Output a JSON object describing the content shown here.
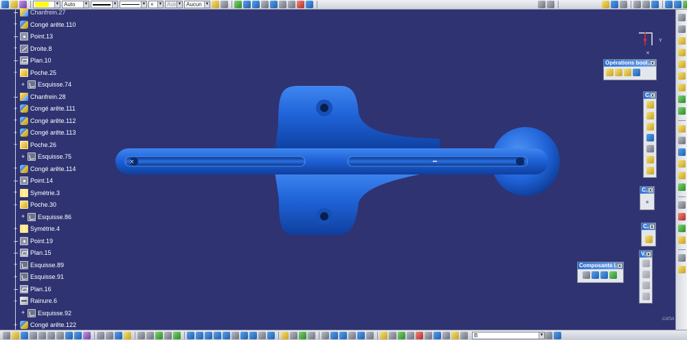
{
  "toolbar_top": {
    "color_value": "",
    "linetype_value": "Auto",
    "layer_value": "Aucun",
    "disabled_value": "Auto"
  },
  "spec_tree": {
    "items": [
      {
        "label": "Chanfrein.27",
        "icon": "chamfer-icon",
        "level": 0,
        "expander": ""
      },
      {
        "label": "Congé arête.110",
        "icon": "edge-fillet-icon",
        "level": 0,
        "expander": "+"
      },
      {
        "label": "Point.13",
        "icon": "point-icon",
        "level": 0,
        "expander": ""
      },
      {
        "label": "Droite.8",
        "icon": "line-icon",
        "level": 0,
        "expander": "+"
      },
      {
        "label": "Plan.10",
        "icon": "plane-icon",
        "level": 0,
        "expander": ""
      },
      {
        "label": "Poche.25",
        "icon": "pocket-icon",
        "level": 0,
        "expander": "−"
      },
      {
        "label": "Esquisse.74",
        "icon": "sketch-icon",
        "level": 1,
        "expander": "+"
      },
      {
        "label": "Chanfrein.28",
        "icon": "chamfer-icon",
        "level": 0,
        "expander": ""
      },
      {
        "label": "Congé arête.111",
        "icon": "edge-fillet-icon",
        "level": 0,
        "expander": "+"
      },
      {
        "label": "Congé arête.112",
        "icon": "edge-fillet-icon",
        "level": 0,
        "expander": "+"
      },
      {
        "label": "Congé arête.113",
        "icon": "edge-fillet-icon",
        "level": 0,
        "expander": "+"
      },
      {
        "label": "Poche.26",
        "icon": "pocket-icon",
        "level": 0,
        "expander": "−"
      },
      {
        "label": "Esquisse.75",
        "icon": "sketch-icon",
        "level": 1,
        "expander": "+"
      },
      {
        "label": "Congé arête.114",
        "icon": "edge-fillet-icon",
        "level": 0,
        "expander": "+"
      },
      {
        "label": "Point.14",
        "icon": "point-icon",
        "level": 0,
        "expander": ""
      },
      {
        "label": "Symétrie.3",
        "icon": "symmetry-icon",
        "level": 0,
        "expander": "+"
      },
      {
        "label": "Poche.30",
        "icon": "pocket-icon",
        "level": 0,
        "expander": "−"
      },
      {
        "label": "Esquisse.86",
        "icon": "sketch-icon",
        "level": 1,
        "expander": "+"
      },
      {
        "label": "Symétrie.4",
        "icon": "symmetry-icon",
        "level": 0,
        "expander": "+"
      },
      {
        "label": "Point.19",
        "icon": "point-icon",
        "level": 0,
        "expander": ""
      },
      {
        "label": "Plan.15",
        "icon": "plane-icon",
        "level": 0,
        "expander": ""
      },
      {
        "label": "Esquisse.89",
        "icon": "sketch-icon",
        "level": 0,
        "expander": "+"
      },
      {
        "label": "Esquisse.91",
        "icon": "sketch-icon",
        "level": 0,
        "expander": "+"
      },
      {
        "label": "Plan.16",
        "icon": "plane-icon",
        "level": 0,
        "expander": ""
      },
      {
        "label": "Rainure.6",
        "icon": "groove-icon",
        "level": 0,
        "expander": "−"
      },
      {
        "label": "Esquisse.92",
        "icon": "sketch-icon",
        "level": 1,
        "expander": "+"
      },
      {
        "label": "Congé arête.122",
        "icon": "edge-fillet-icon",
        "level": 0,
        "expander": "+"
      }
    ]
  },
  "palettes": {
    "boolean_ops": {
      "title": "Opérations bool...",
      "close": "x"
    },
    "dress_up": {
      "title": "C...",
      "close": "x"
    },
    "small1": {
      "title": "C...",
      "close": "x"
    },
    "small2": {
      "title": "C...",
      "close": "x"
    },
    "components": {
      "title": "Composants i...",
      "close": "x"
    },
    "v_palette": {
      "title": "V...",
      "close": "x"
    }
  },
  "compass": {
    "axis_label": "Y"
  },
  "bottom_toolbar": {
    "command_value": "B"
  },
  "brand": {
    "logo_text": "CATIA"
  },
  "colors": {
    "background": "#2f3372",
    "part_blue": "#1f63d8",
    "tree_text": "#ffffff",
    "palette_title": "#2d6fd2"
  }
}
